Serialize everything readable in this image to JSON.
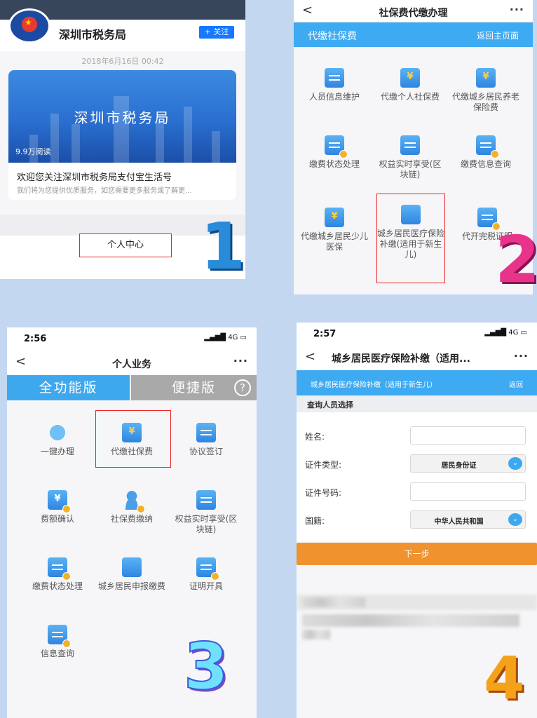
{
  "panel1": {
    "account_name": "深圳市税务局",
    "follow_button": "+ 关注",
    "date": "2018年6月16日  00:42",
    "banner_title": "深圳市税务局",
    "read_count": "9.9万阅读",
    "article_title": "欢迎您关注深圳市税务局支付宝生活号",
    "article_summary": "我们将为您提供优质服务，如您需要更多服务或了解更...",
    "personal_center": "个人中心"
  },
  "panel2": {
    "nav_title": "社保费代缴办理",
    "bar_title": "代缴社保费",
    "bar_link": "返回主页面",
    "items": [
      {
        "label": "人员信息维护",
        "icon": "id-card-icon"
      },
      {
        "label": "代缴个人社保费",
        "icon": "phone-yuan-icon"
      },
      {
        "label": "代缴城乡居民养老保险费",
        "icon": "phone-yuan-icon"
      },
      {
        "label": "缴费状态处理",
        "icon": "document-star-icon"
      },
      {
        "label": "权益实时享受(区块链)",
        "icon": "blockchain-card-icon"
      },
      {
        "label": "缴费信息查询",
        "icon": "document-search-icon"
      },
      {
        "label": "代缴城乡居民少儿医保",
        "icon": "phone-yuan-icon"
      },
      {
        "label": "城乡居民医疗保险补缴(适用于新生儿)",
        "icon": "building-icon"
      },
      {
        "label": "代开完税证明",
        "icon": "document-star-icon"
      }
    ]
  },
  "panel3": {
    "time": "2:56",
    "network": "4G",
    "nav_title": "个人业务",
    "tab_full": "全功能版",
    "tab_quick": "便捷版",
    "help": "?",
    "items": [
      {
        "label": "一键办理",
        "icon": "cursor-bubble-icon"
      },
      {
        "label": "代缴社保费",
        "icon": "phone-yuan-icon"
      },
      {
        "label": "协议签订",
        "icon": "id-card-icon"
      },
      {
        "label": "费额确认",
        "icon": "yuan-check-icon"
      },
      {
        "label": "社保费缴纳",
        "icon": "user-coin-icon"
      },
      {
        "label": "权益实时享受(区块链)",
        "icon": "blockchain-card-icon"
      },
      {
        "label": "缴费状态处理",
        "icon": "document-star-icon"
      },
      {
        "label": "城乡居民申报缴费",
        "icon": "building-icon"
      },
      {
        "label": "证明开具",
        "icon": "document-star-icon"
      },
      {
        "label": "信息查询",
        "icon": "document-search-icon"
      }
    ]
  },
  "panel4": {
    "time": "2:57",
    "network": "4G",
    "nav_title": "城乡居民医疗保险补缴（适用...",
    "bar_title": "城乡居民医疗保险补缴（适用于新生儿）",
    "bar_link": "返回",
    "section": "查询人员选择",
    "name_label": "姓名:",
    "id_type_label": "证件类型:",
    "id_type_value": "居民身份证",
    "id_number_label": "证件号码:",
    "nationality_label": "国籍:",
    "nationality_value": "中华人民共和国",
    "next_button": "下一步"
  },
  "step_numbers": [
    "1",
    "2",
    "3",
    "4"
  ],
  "colors": {
    "accent_blue": "#3eaaf2",
    "tab_inactive": "#a9a9a9",
    "next_orange": "#f0932e",
    "highlight_red": "#ee2222"
  }
}
